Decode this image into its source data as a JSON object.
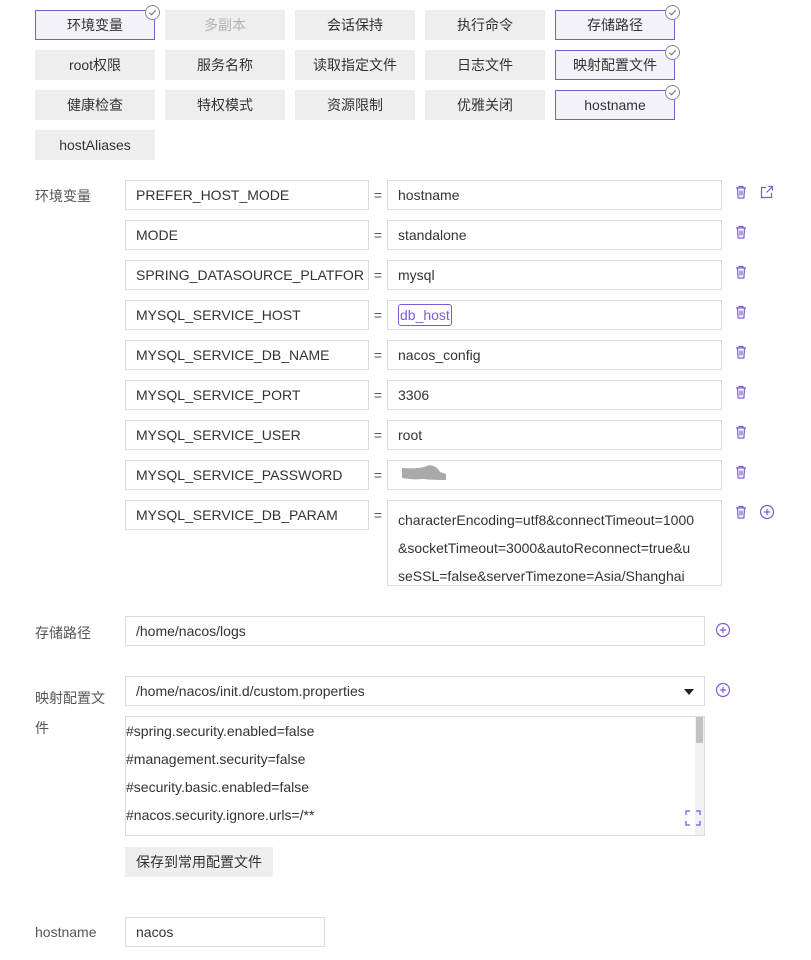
{
  "tags": [
    {
      "label": "环境变量",
      "selected": true
    },
    {
      "label": "多副本",
      "disabled": true
    },
    {
      "label": "会话保持"
    },
    {
      "label": "执行命令"
    },
    {
      "label": "存储路径",
      "selected": true
    },
    {
      "label": "root权限"
    },
    {
      "label": "服务名称"
    },
    {
      "label": "读取指定文件"
    },
    {
      "label": "日志文件"
    },
    {
      "label": "映射配置文件",
      "selected": true
    },
    {
      "label": "健康检查"
    },
    {
      "label": "特权模式"
    },
    {
      "label": "资源限制"
    },
    {
      "label": "优雅关闭"
    },
    {
      "label": "hostname",
      "selected": true
    },
    {
      "label": "hostAliases"
    }
  ],
  "env": {
    "label": "环境变量",
    "equals": "=",
    "rows": [
      {
        "key": "PREFER_HOST_MODE",
        "value": "hostname"
      },
      {
        "key": "MODE",
        "value": "standalone"
      },
      {
        "key": "SPRING_DATASOURCE_PLATFOR",
        "value": "mysql"
      },
      {
        "key": "MYSQL_SERVICE_HOST",
        "value": "db_host"
      },
      {
        "key": "MYSQL_SERVICE_DB_NAME",
        "value": "nacos_config"
      },
      {
        "key": "MYSQL_SERVICE_PORT",
        "value": "3306"
      },
      {
        "key": "MYSQL_SERVICE_USER",
        "value": "root"
      },
      {
        "key": "MYSQL_SERVICE_PASSWORD",
        "value": ""
      },
      {
        "key": "MYSQL_SERVICE_DB_PARAM",
        "value_lines": [
          "characterEncoding=utf8&connectTimeout=1000",
          "&socketTimeout=3000&autoReconnect=true&u",
          "seSSL=false&serverTimezone=Asia/Shanghai"
        ]
      }
    ]
  },
  "storage": {
    "label": "存储路径",
    "path": "/home/nacos/logs"
  },
  "config_map": {
    "label_line1": "映射配置文",
    "label_line2": "件",
    "selected_file": "/home/nacos/init.d/custom.properties",
    "content_lines": [
      "#spring.security.enabled=false",
      "#management.security=false",
      "#security.basic.enabled=false",
      "#nacos.security.ignore.urls=/**"
    ],
    "save_button": "保存到常用配置文件"
  },
  "hostname": {
    "label": "hostname",
    "value": "nacos"
  },
  "colors": {
    "accent": "#7b5cd6",
    "tag_bg": "#eeeeee",
    "border": "#dcdcdc"
  }
}
